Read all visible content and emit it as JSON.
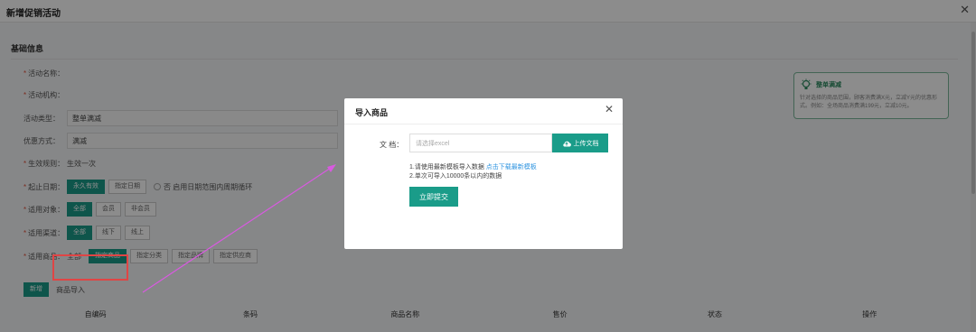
{
  "window": {
    "title": "新增促销活动"
  },
  "section": {
    "title": "基础信息"
  },
  "form": {
    "name_label": "活动名称：",
    "org_label": "活动机构：",
    "type_label": "活动类型：",
    "type_value": "整单满减",
    "discount_label": "优惠方式：",
    "discount_value": "满减",
    "rule_label": "生效规则：",
    "rule_value": "生效一次",
    "date_label": "起止日期：",
    "date_opts": [
      "永久有效",
      "指定日期"
    ],
    "date_cycle": "否  启用日期范围内周期循环",
    "target_label": "适用对象：",
    "target_opts": [
      "全部",
      "会员",
      "非会员"
    ],
    "channel_label": "适用渠道：",
    "channel_opts": [
      "全部",
      "线下",
      "线上"
    ],
    "goods_label": "适用商品：",
    "goods_all": "全部",
    "goods_opts": [
      "指定商品",
      "指定分类",
      "指定品牌",
      "指定供应商"
    ]
  },
  "tip": {
    "title": "整单满减",
    "desc": "针对选择的商品范围，顾客消费满X元，立减Y元的优惠形式。例如：全场商品消费满199元，立减10元。"
  },
  "table": {
    "add_button": "新增",
    "import_button": "商品导入",
    "headers": [
      "自编码",
      "条码",
      "商品名称",
      "售价",
      "状态",
      "操作"
    ]
  },
  "modal": {
    "title": "导入商品",
    "doc_label": "文 档：",
    "doc_placeholder": "请选择excel",
    "upload_button": "上传文档",
    "note1_prefix": "1.请使用最新模板导入数据 ",
    "note1_link": "点击下载最新模板",
    "note2": "2.单次可导入10000条以内的数据",
    "submit_button": "立即提交"
  },
  "colors": {
    "accent": "#1a9c89",
    "link": "#2f94e0",
    "annotation_box": "#e04545",
    "annotation_arrow": "#d85ae0"
  }
}
